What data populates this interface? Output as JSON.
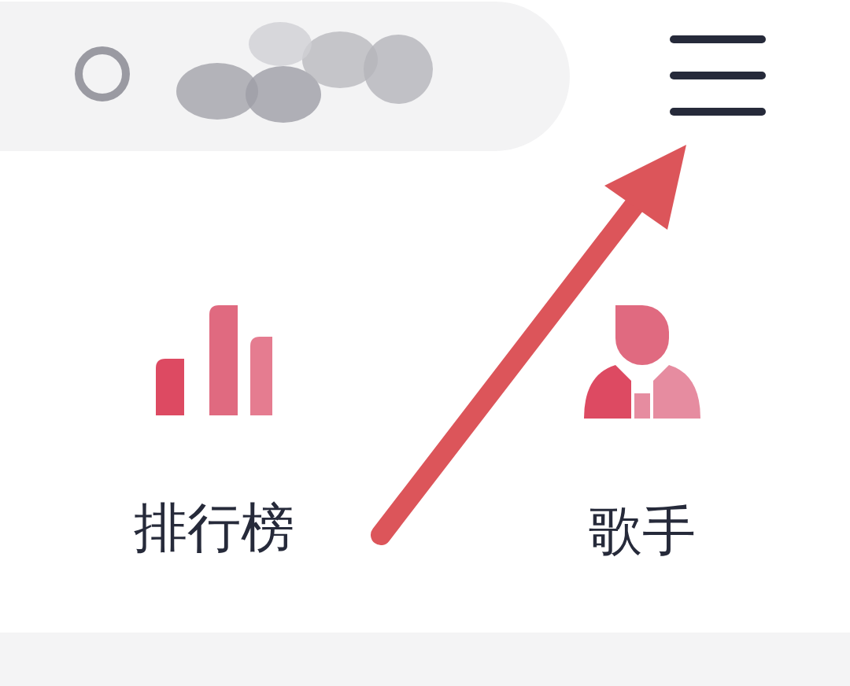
{
  "search": {
    "query_redacted": true
  },
  "categories": [
    {
      "label": "排行榜",
      "kind": "chart"
    },
    {
      "label": "歌手",
      "kind": "singer"
    }
  ]
}
